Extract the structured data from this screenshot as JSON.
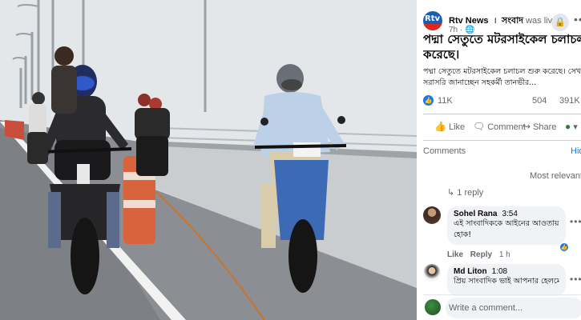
{
  "post": {
    "page_name": "Rtv News",
    "page_label": "সংবাদ",
    "live_text": "was live.",
    "time": "7h",
    "avatar_text": "Rtv",
    "headline_line1": "পদ্মা সেতুতে মটরসাইকেল চলাচল শুরু",
    "headline_line2": "করেছে।",
    "body_line1": "পদ্মা সেতুতে মটরসাইকেল চলাচল শুরু করেছে। সেখান থেকে",
    "body_line2": "সরাসরি জানাচ্ছেন সহকর্মী তানভীর...",
    "reactions": "11K",
    "comments": "504",
    "shares": "391K",
    "more": "•••"
  },
  "actions": {
    "like": "Like",
    "comment": "Comment",
    "share": "Share"
  },
  "comments_section": {
    "title": "Comments",
    "hide": "Hide",
    "sort": "Most relevant ▾",
    "replies": "1 reply"
  },
  "comments": [
    {
      "name": "Sohel Rana",
      "time": "3:54",
      "text_line1": "এই সাংবাদিককে আইনের আওতায় আনা",
      "text_line2": "হোক!",
      "like": "Like",
      "reply": "Reply",
      "age": "1 h"
    },
    {
      "name": "Md Liton",
      "time": "1:08",
      "text_line1": "প্রিয় সাংবাদিক ভাই আপনার হেলমেট",
      "text_line2": ""
    }
  ],
  "composer": {
    "placeholder": "Write a comment..."
  },
  "colors": {
    "accent": "#1877f2",
    "brand": "#1b5fb0",
    "brand_red": "#e1261c"
  }
}
